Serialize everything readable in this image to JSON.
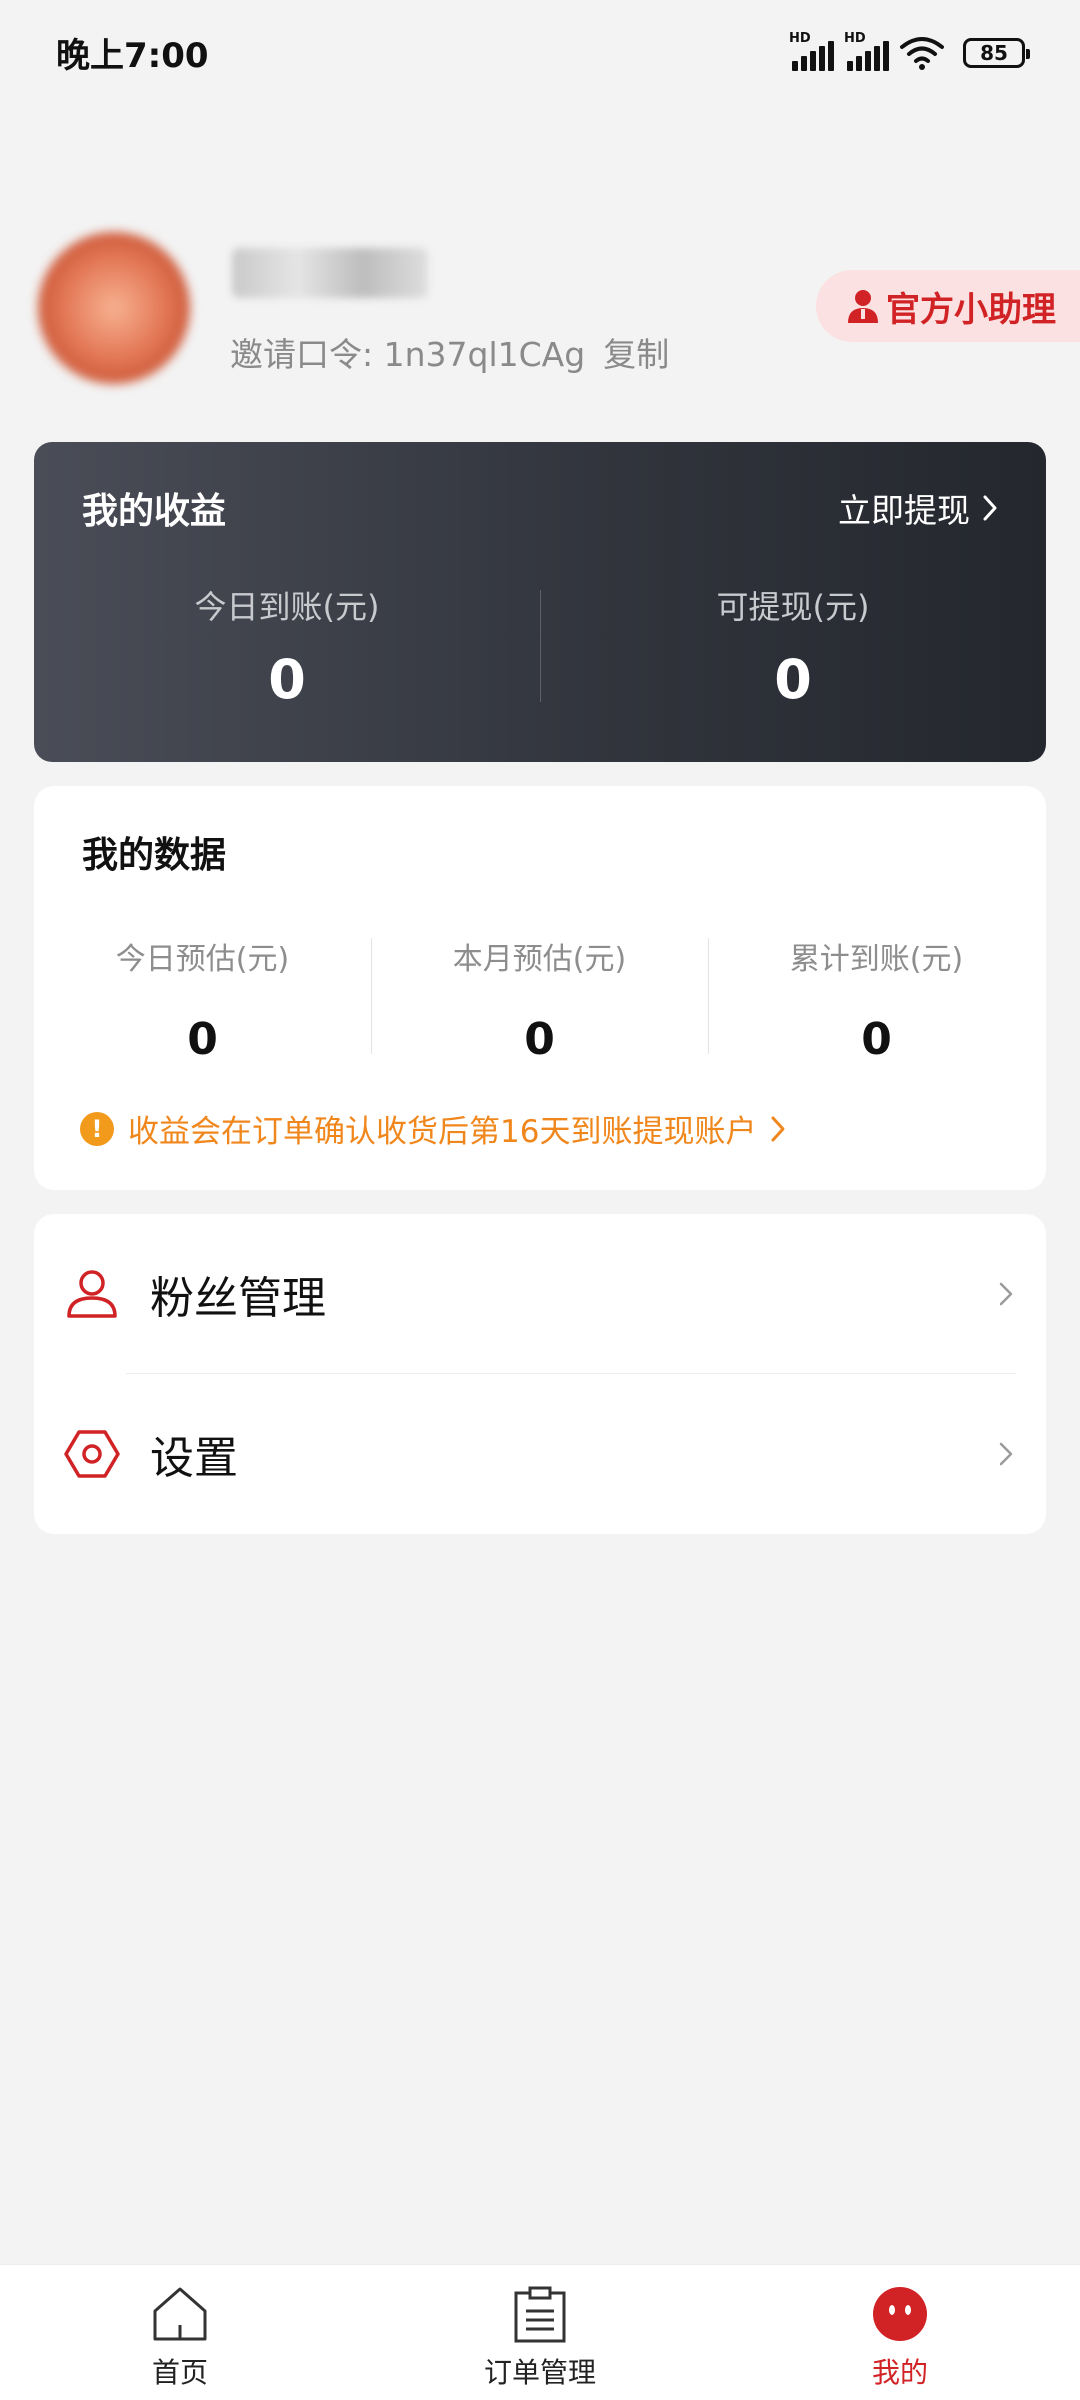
{
  "status_bar": {
    "time": "晚上7:00",
    "signal_1_label": "HD",
    "signal_2_label": "HD",
    "battery": "85"
  },
  "profile": {
    "invite_label": "邀请口令: 1n37ql1CAg",
    "copy_label": "复制",
    "helper_label": "官方小助理"
  },
  "earnings": {
    "title": "我的收益",
    "withdraw_label": "立即提现",
    "today_label": "今日到账(元)",
    "today_value": "0",
    "available_label": "可提现(元)",
    "available_value": "0"
  },
  "data_card": {
    "title": "我的数据",
    "columns": [
      {
        "label": "今日预估(元)",
        "value": "0"
      },
      {
        "label": "本月预估(元)",
        "value": "0"
      },
      {
        "label": "累计到账(元)",
        "value": "0"
      }
    ],
    "notice": "收益会在订单确认收货后第16天到账提现账户"
  },
  "menu": {
    "items": [
      {
        "label": "粉丝管理",
        "icon": "user-icon"
      },
      {
        "label": "设置",
        "icon": "settings-icon"
      }
    ]
  },
  "bottom_nav": {
    "items": [
      {
        "label": "首页",
        "icon": "home-icon"
      },
      {
        "label": "订单管理",
        "icon": "clipboard-icon"
      },
      {
        "label": "我的",
        "icon": "profile-face-icon"
      }
    ],
    "active_index": 2
  },
  "colors": {
    "accent": "#d12326",
    "notice": "#f0871c",
    "card_dark": "#2f323a"
  }
}
